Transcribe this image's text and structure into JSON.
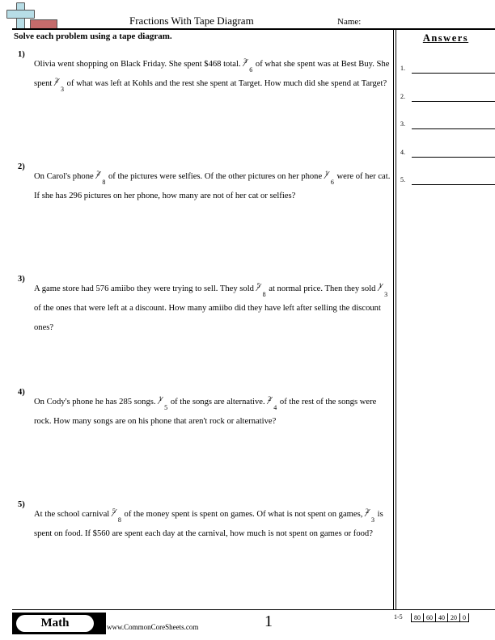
{
  "header": {
    "logo_icon": "plus-tape-logo-icon",
    "title": "Fractions With Tape Diagram",
    "name_label": "Name:"
  },
  "instructions": "Solve each problem using a tape diagram.",
  "answers": {
    "title": "Answers",
    "items": [
      "1.",
      "2.",
      "3.",
      "4.",
      "5."
    ]
  },
  "problems": [
    {
      "number": "1)",
      "parts": [
        {
          "t": "Olivia went shopping on Black Friday. She spent $468 total. "
        },
        {
          "n": "3",
          "d": "6"
        },
        {
          "t": " of what she spent was at Best Buy. She spent "
        },
        {
          "n": "2",
          "d": "3"
        },
        {
          "t": " of what was left at Kohls and the rest she spent at Target. How much did she spend at Target?"
        }
      ]
    },
    {
      "number": "2)",
      "parts": [
        {
          "t": "On Carol's phone "
        },
        {
          "n": "2",
          "d": "8"
        },
        {
          "t": " of the pictures were selfies. Of the other pictures on her phone "
        },
        {
          "n": "1",
          "d": "6"
        },
        {
          "t": " were of her cat. If she has 296 pictures on her phone, how many are not of her cat or selfies?"
        }
      ]
    },
    {
      "number": "3)",
      "parts": [
        {
          "t": "A game store had 576 amiibo they were trying to sell. They sold "
        },
        {
          "n": "5",
          "d": "8"
        },
        {
          "t": " at normal price. Then they sold "
        },
        {
          "n": "1",
          "d": "3"
        },
        {
          "t": " of the ones that were left at a discount. How many amiibo did they have left after selling the discount ones?"
        }
      ]
    },
    {
      "number": "4)",
      "parts": [
        {
          "t": "On Cody's phone he has 285 songs. "
        },
        {
          "n": "1",
          "d": "5"
        },
        {
          "t": " of the songs are alternative. "
        },
        {
          "n": "2",
          "d": "4"
        },
        {
          "t": " of the rest of the songs were rock. How many songs are on his phone that aren't rock or alternative?"
        }
      ]
    },
    {
      "number": "5)",
      "parts": [
        {
          "t": "At the school carnival "
        },
        {
          "n": "5",
          "d": "8"
        },
        {
          "t": " of the money spent is spent on games. Of what is not spent on games, "
        },
        {
          "n": "2",
          "d": "3"
        },
        {
          "t": " is spent on food. If $560 are spent each day at the carnival, how much is not spent on games or food?"
        }
      ]
    }
  ],
  "footer": {
    "subject": "Math",
    "site": "www.CommonCoreSheets.com",
    "page": "1",
    "score_range": "1-5",
    "scores": [
      "80",
      "60",
      "40",
      "20",
      "0"
    ]
  }
}
